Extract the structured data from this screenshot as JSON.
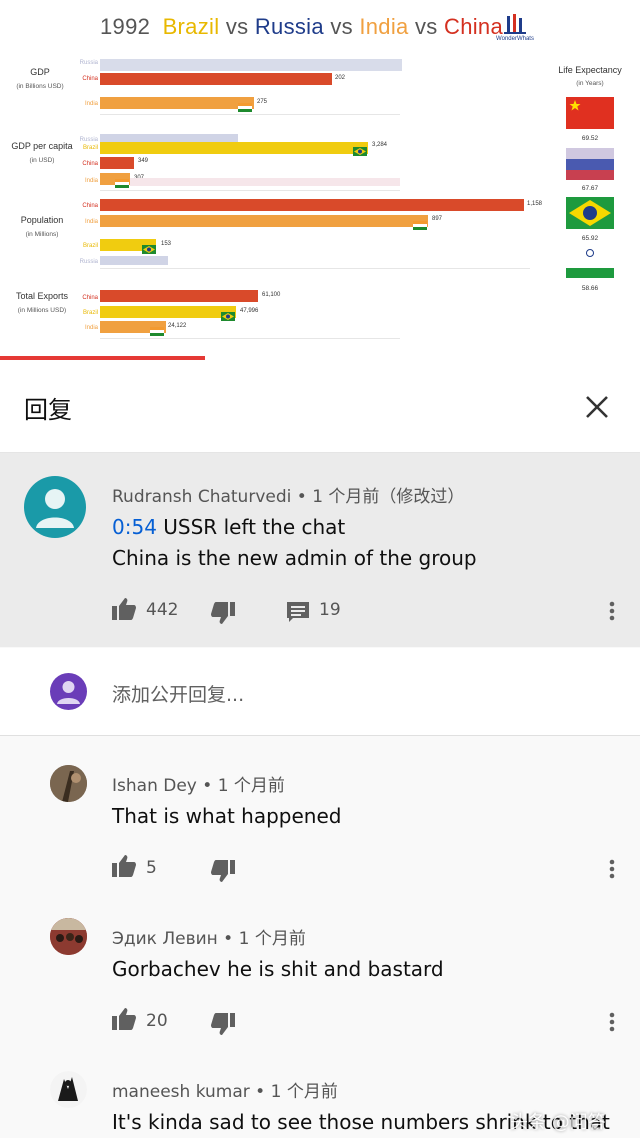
{
  "video": {
    "year": "1992",
    "title_parts": [
      "Brazil",
      "vs",
      "Russia",
      "vs",
      "India",
      "vs",
      "China"
    ],
    "logo_text": "WonderWhats",
    "groups": [
      {
        "name": "GDP",
        "sub": "(in Billions USD)",
        "rows": [
          {
            "country": "Russia",
            "value": ""
          },
          {
            "country": "China",
            "value": "202"
          },
          {
            "country": "India",
            "value": "275"
          }
        ]
      },
      {
        "name": "GDP per capita",
        "sub": "(in USD)",
        "rows": [
          {
            "country": "Russia",
            "value": ""
          },
          {
            "country": "Brazil",
            "value": "3,284"
          },
          {
            "country": "China",
            "value": "349"
          },
          {
            "country": "India",
            "value": "307"
          }
        ]
      },
      {
        "name": "Population",
        "sub": "(in Millions)",
        "rows": [
          {
            "country": "China",
            "value": "1,158"
          },
          {
            "country": "India",
            "value": "897"
          },
          {
            "country": "Brazil",
            "value": "153"
          },
          {
            "country": "Russia",
            "value": ""
          }
        ]
      },
      {
        "name": "Total Exports",
        "sub": "(in Millions USD)",
        "rows": [
          {
            "country": "China",
            "value": "61,100"
          },
          {
            "country": "Brazil",
            "value": "47,996"
          },
          {
            "country": "India",
            "value": "24,122"
          }
        ]
      }
    ],
    "life_expectancy": {
      "title": "Life Expectancy",
      "sub": "(in Years)",
      "entries": [
        {
          "country": "China",
          "value": "69.52"
        },
        {
          "country": "Russia",
          "value": "67.67"
        },
        {
          "country": "Brazil",
          "value": "65.92"
        },
        {
          "country": "India",
          "value": "58.66"
        }
      ]
    },
    "progress": 0.32
  },
  "panel": {
    "title": "回复",
    "close_icon": "close-icon"
  },
  "main_comment": {
    "author": "Rudransh Chaturvedi",
    "meta": " • 1 个月前（修改过）",
    "timestamp": "0:54",
    "line1_rest": " USSR left the chat",
    "line2": "China is the new admin of the group",
    "likes": "442",
    "replies": "19",
    "avatar_color": "#1a9aa8"
  },
  "add_reply": {
    "placeholder": "添加公开回复...",
    "avatar_color": "#6a3db8"
  },
  "replies": [
    {
      "author": "Ishan Dey",
      "meta": " • 1 个月前",
      "text": "That is what happened",
      "likes": "5"
    },
    {
      "author": "Эдик Левин",
      "meta": " • 1 个月前",
      "text": "Gorbachev he is shit and bastard",
      "likes": "20"
    },
    {
      "author": "maneesh kumar",
      "meta": " • 1 个月前",
      "text": "It's kinda sad to see those numbers shrink to that",
      "likes": ""
    }
  ],
  "watermark": "头条 @问答"
}
